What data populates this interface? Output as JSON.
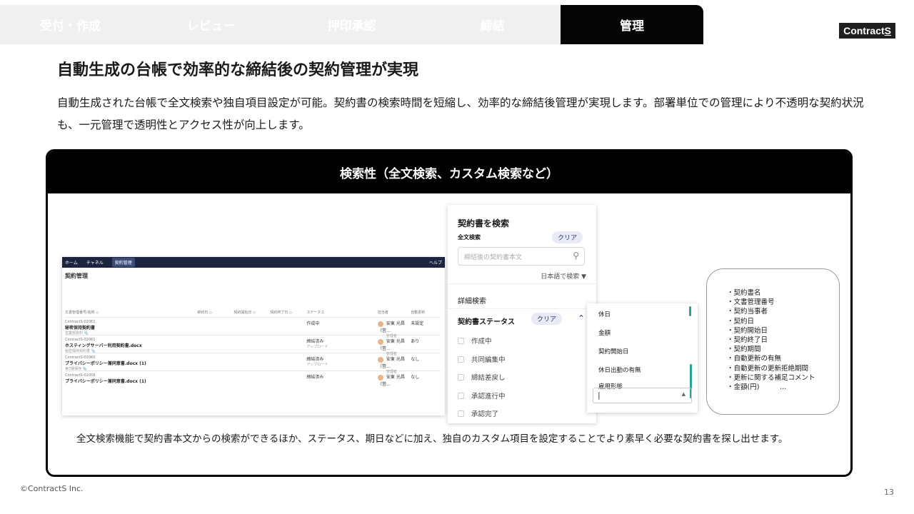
{
  "steps": [
    {
      "label": "受付・作成"
    },
    {
      "label": "レビュー"
    },
    {
      "label": "押印承認"
    },
    {
      "label": "締結"
    },
    {
      "label": "管理"
    }
  ],
  "brand": {
    "logo_text": "Contract",
    "logo_suffix": "S"
  },
  "heading": "自動生成の台帳で効率的な締結後の契約管理が実現",
  "lead": "自動生成された台帳で全文検索や独自項目設定が可能。契約書の検索時間を短縮し、効率的な締結後管理が実現します。部署単位での管理により不透明な契約状況も、一元管理で透明性とアクセス性が向上します。",
  "box": {
    "title": "検索性（全文検索、カスタム検索など）",
    "caption": "全文検索機能で契約書本文からの検索ができるほか、ステータス、期日などに加え、独自のカスタム項目を設定することでより素早く必要な契約書を探し出せます。"
  },
  "mock_app": {
    "nav": [
      "ホーム",
      "チャネル",
      "契約管理"
    ],
    "help": "ヘルプ",
    "page_title": "契約管理",
    "columns": [
      "文書管理番号/名称 ◇",
      "締約日 ◇",
      "契約開始日 ◇",
      "契約終了日 ◇",
      "ステータス",
      "担当者",
      "自動更新"
    ],
    "rows": [
      {
        "id": "ContractS-02062",
        "name": "秘密保持契約書",
        "sub": "営業部資料 📎",
        "status": "作成中",
        "status2": "",
        "owner": "安東 光昌（営…",
        "role": "管理者",
        "renew": "未設定"
      },
      {
        "id": "ContractS-02061",
        "name": "ホスティングサーバー利用契約書.docx",
        "sub": "秘密保持契約書 📎",
        "status": "締結済み",
        "status2": "アップロード",
        "owner": "安東 光昌（営…",
        "role": "管理者",
        "renew": "あり"
      },
      {
        "id": "ContractS-02060",
        "name": "プライバシーポリシー兼同意書.docx (1)",
        "sub": "第7期保存 📎",
        "status": "締結済み",
        "status2": "アップロード",
        "owner": "安東 光昌（営…",
        "role": "管理者",
        "renew": "なし"
      },
      {
        "id": "ContractS-02059",
        "name": "プライバシーポリシー兼同意書.docx (1)",
        "sub": "",
        "status": "締結済み",
        "status2": "",
        "owner": "安東 光昌（営…",
        "role": "",
        "renew": "なし"
      }
    ]
  },
  "search_panel": {
    "title": "契約書を検索",
    "fulltext_label": "全文検索",
    "clear": "クリア",
    "input_placeholder": "締結後の契約書本文",
    "lang": "日本語で検索 ▼",
    "detail": "詳細検索",
    "status_label": "契約書ステータス",
    "status_options": [
      "作成中",
      "共同編集中",
      "締結差戻し",
      "承認進行中",
      "承認完了"
    ]
  },
  "dropdown": {
    "items": [
      "休日",
      "金額",
      "契約開始日",
      "休日出勤の有無",
      "雇用形態"
    ],
    "input_value": "|"
  },
  "field_list": [
    "・契約書名",
    "・文書管理番号",
    "・契約当事者",
    "・契約日",
    "・契約開始日",
    "・契約終了日",
    "・契約期間",
    "・自動更新の有無",
    "・自動更新の更新拒絶期間",
    "・更新に関する補足コメント",
    "・金額(円)　　　…"
  ],
  "footer": {
    "copyright": "©ContractS Inc.",
    "page": "13"
  },
  "colors": {
    "active_tab": "#050505",
    "inactive_tab": "#f0f0f0",
    "accent": "#2a3570",
    "scroll": "#2aa19a"
  }
}
